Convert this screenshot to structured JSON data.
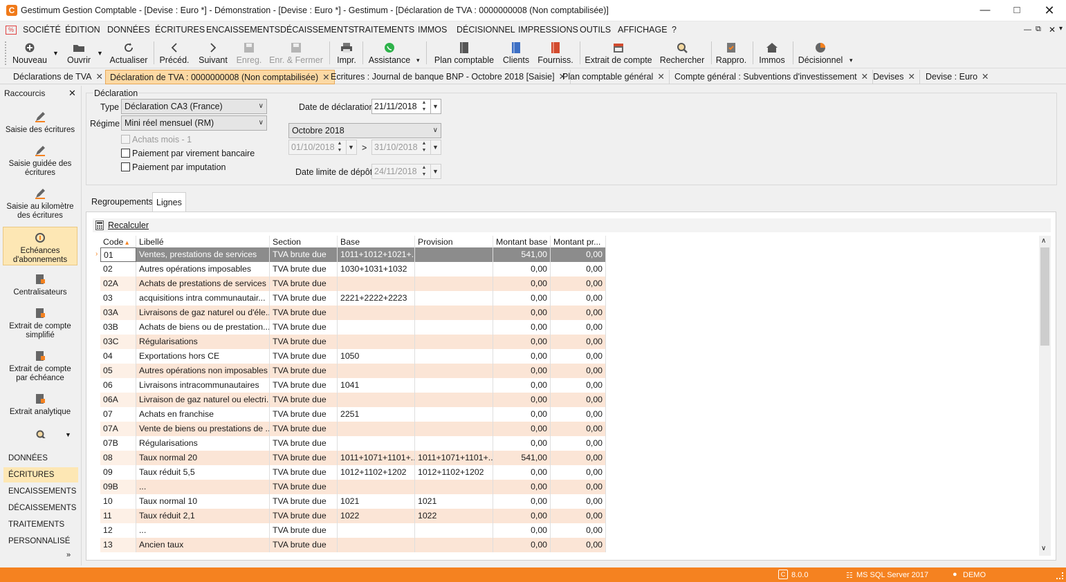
{
  "window": {
    "title": "Gestimum Gestion Comptable - [Devise : Euro *] - Démonstration - [Devise : Euro *] - Gestimum - [Déclaration de TVA : 0000000008 (Non comptabilisée)]",
    "app_icon": "C"
  },
  "menu": [
    "SOCIÉTÉ",
    "ÉDITION",
    "DONNÉES",
    "ÉCRITURES",
    "ENCAISSEMENTS",
    "DÉCAISSEMENTS",
    "TRAITEMENTS",
    "IMMOS",
    "DÉCISIONNEL",
    "IMPRESSIONS",
    "OUTILS",
    "AFFICHAGE",
    "?"
  ],
  "toolbar": {
    "nouveau": "Nouveau",
    "ouvrir": "Ouvrir",
    "actualiser": "Actualiser",
    "preced": "Précéd.",
    "suivant": "Suivant",
    "enreg": "Enreg.",
    "enreg_fermer": "Enr. & Fermer",
    "impr": "Impr.",
    "assistance": "Assistance",
    "plan": "Plan comptable",
    "clients": "Clients",
    "fourniss": "Fourniss.",
    "extrait": "Extrait de compte",
    "rechercher": "Rechercher",
    "rappro": "Rappro.",
    "immos": "Immos",
    "decisionnel": "Décisionnel"
  },
  "doc_tabs": [
    "Déclarations de TVA",
    "Déclaration de TVA : 0000000008 (Non comptabilisée)",
    "Ecritures : Journal de banque BNP - Octobre 2018 [Saisie]",
    "Plan comptable général",
    "Compte général : Subventions d'investissement",
    "Devises",
    "Devise : Euro"
  ],
  "sidebar": {
    "title": "Raccourcis",
    "shortcuts": [
      "Saisie des écritures",
      "Saisie guidée des écritures",
      "Saisie au kilomètre des écritures",
      "Echéances d'abonnements",
      "Centralisateurs",
      "Extrait de compte simplifié",
      "Extrait de compte par échéance",
      "Extrait analytique"
    ],
    "nav": [
      "DONNÉES",
      "ÉCRITURES",
      "ENCAISSEMENTS",
      "DÉCAISSEMENTS",
      "TRAITEMENTS",
      "PERSONNALISÉ"
    ]
  },
  "form": {
    "group_label": "Déclaration",
    "type_label": "Type",
    "type_value": "Déclaration CA3 (France)",
    "regime_label": "Régime",
    "regime_value": "Mini réel mensuel (RM)",
    "achats": "Achats mois - 1",
    "virement": "Paiement par virement bancaire",
    "imputation": "Paiement par imputation",
    "date_decl_label": "Date de déclaration",
    "date_decl": "21/11/2018",
    "period": "Octobre 2018",
    "date_from": "01/10/2018",
    "date_sep": ">",
    "date_to": "31/10/2018",
    "limit_label": "Date limite de dépôt",
    "limit_date": "24/11/2018"
  },
  "panel_tabs": [
    "Regroupements",
    "Lignes"
  ],
  "recalc": "Recalculer",
  "grid": {
    "headers": [
      "Code",
      "Libellé",
      "Section",
      "Base",
      "Provision",
      "Montant base",
      "Montant pr..."
    ],
    "rows": [
      [
        "01",
        "Ventes, prestations de services",
        "TVA brute due",
        "1011+1012+1021+...",
        "",
        "541,00",
        "0,00"
      ],
      [
        "02",
        "Autres opérations imposables",
        "TVA brute due",
        "1030+1031+1032",
        "",
        "0,00",
        "0,00"
      ],
      [
        "02A",
        "Achats de prestations de services ...",
        "TVA brute due",
        "",
        "",
        "0,00",
        "0,00"
      ],
      [
        "03",
        "acquisitions intra communautair...",
        "TVA brute due",
        "2221+2222+2223",
        "",
        "0,00",
        "0,00"
      ],
      [
        "03A",
        "Livraisons de gaz naturel ou d'éle...",
        "TVA brute due",
        "",
        "",
        "0,00",
        "0,00"
      ],
      [
        "03B",
        "Achats de biens ou de prestation...",
        "TVA brute due",
        "",
        "",
        "0,00",
        "0,00"
      ],
      [
        "03C",
        "Régularisations",
        "TVA brute due",
        "",
        "",
        "0,00",
        "0,00"
      ],
      [
        "04",
        "Exportations hors CE",
        "TVA brute due",
        "1050",
        "",
        "0,00",
        "0,00"
      ],
      [
        "05",
        "Autres opérations non imposables",
        "TVA brute due",
        "",
        "",
        "0,00",
        "0,00"
      ],
      [
        "06",
        "Livraisons intracommunautaires",
        "TVA brute due",
        "1041",
        "",
        "0,00",
        "0,00"
      ],
      [
        "06A",
        "Livraison de gaz naturel ou electri...",
        "TVA brute due",
        "",
        "",
        "0,00",
        "0,00"
      ],
      [
        "07",
        "Achats en franchise",
        "TVA brute due",
        "2251",
        "",
        "0,00",
        "0,00"
      ],
      [
        "07A",
        "Vente de biens ou prestations de ...",
        "TVA brute due",
        "",
        "",
        "0,00",
        "0,00"
      ],
      [
        "07B",
        "Régularisations",
        "TVA brute due",
        "",
        "",
        "0,00",
        "0,00"
      ],
      [
        "08",
        "Taux normal 20",
        "TVA brute due",
        "1011+1071+1101+...",
        "1011+1071+1101+...",
        "541,00",
        "0,00"
      ],
      [
        "09",
        "Taux réduit 5,5",
        "TVA brute due",
        "1012+1102+1202",
        "1012+1102+1202",
        "0,00",
        "0,00"
      ],
      [
        "09B",
        "...",
        "TVA brute due",
        "",
        "",
        "0,00",
        "0,00"
      ],
      [
        "10",
        "Taux normal 10",
        "TVA brute due",
        "1021",
        "1021",
        "0,00",
        "0,00"
      ],
      [
        "11",
        "Taux réduit 2,1",
        "TVA brute due",
        "1022",
        "1022",
        "0,00",
        "0,00"
      ],
      [
        "12",
        "...",
        "TVA brute due",
        "",
        "",
        "0,00",
        "0,00"
      ],
      [
        "13",
        "Ancien taux",
        "TVA brute due",
        "",
        "",
        "0,00",
        "0,00"
      ]
    ]
  },
  "status": {
    "version": "8.0.0",
    "server": "MS SQL Server 2017",
    "user": "DEMO"
  },
  "colors": {
    "accent": "#f58220",
    "row_alt": "#fbe5d6",
    "row_selected": "#8c8c8c",
    "tab_active": "#fcd9a4"
  }
}
